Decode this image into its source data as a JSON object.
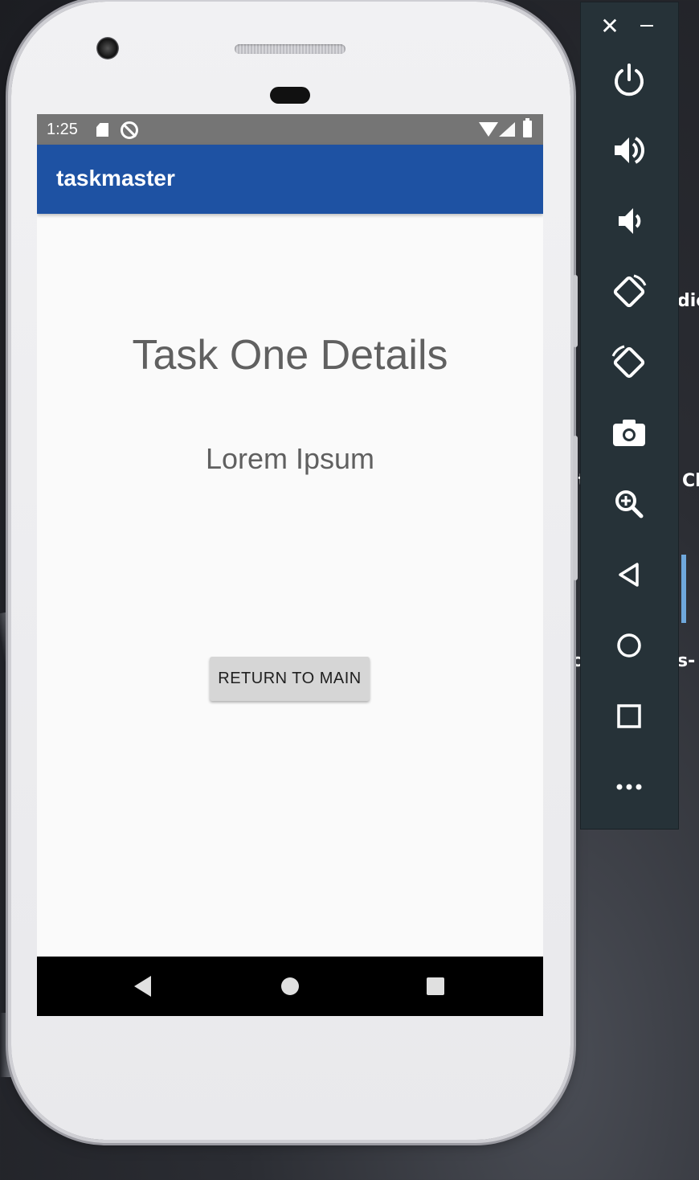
{
  "status_bar": {
    "time": "1:25"
  },
  "app_bar": {
    "title": "taskmaster"
  },
  "task_detail": {
    "title": "Task One Details",
    "body": "Lorem Ipsum",
    "return_button_label": "RETURN TO MAIN"
  },
  "emulator_panel": {
    "close_glyph": "✕",
    "tools": [
      "power-icon",
      "volume-up-icon",
      "volume-down-icon",
      "rotate-left-icon",
      "rotate-right-icon",
      "camera-icon",
      "zoom-icon",
      "back-icon",
      "home-icon",
      "overview-icon",
      "more-icon"
    ]
  },
  "background_fragments": [
    "ı",
    "dio",
    "ıt",
    "Cl",
    "c",
    "s-"
  ],
  "colors": {
    "app_bar": "#1e52a3",
    "status_bar": "#757575",
    "panel": "#263238",
    "screen_bg": "#fafafa"
  }
}
